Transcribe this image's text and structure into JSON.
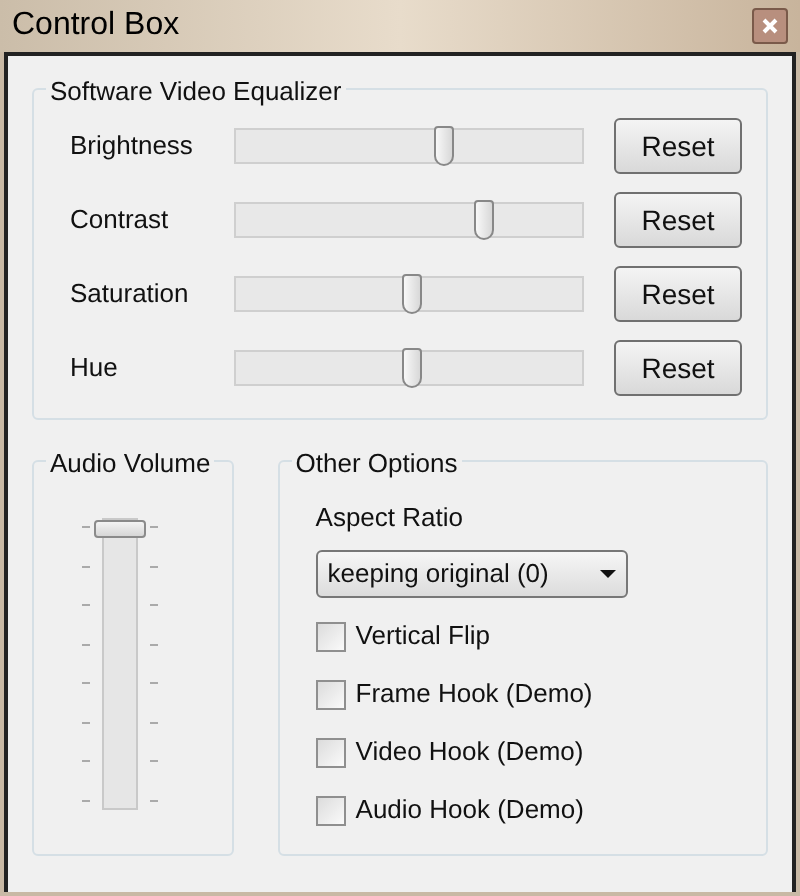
{
  "window": {
    "title": "Control Box"
  },
  "equalizer": {
    "title": "Software Video Equalizer",
    "rows": [
      {
        "label": "Brightness",
        "level": 0.6,
        "button": "Reset"
      },
      {
        "label": "Contrast",
        "level": 0.72,
        "button": "Reset"
      },
      {
        "label": "Saturation",
        "level": 0.5,
        "button": "Reset"
      },
      {
        "label": "Hue",
        "level": 0.5,
        "button": "Reset"
      }
    ]
  },
  "audio_volume": {
    "title": "Audio Volume",
    "level": 1
  },
  "other_options": {
    "title": "Other Options",
    "aspect_ratio": {
      "label": "Aspect Ratio",
      "value": "keeping original (0)"
    },
    "checkboxes": [
      {
        "label": "Vertical Flip",
        "checked": false
      },
      {
        "label": "Frame Hook (Demo)",
        "checked": false
      },
      {
        "label": "Video Hook (Demo)",
        "checked": false
      },
      {
        "label": "Audio Hook (Demo)",
        "checked": false
      }
    ]
  }
}
